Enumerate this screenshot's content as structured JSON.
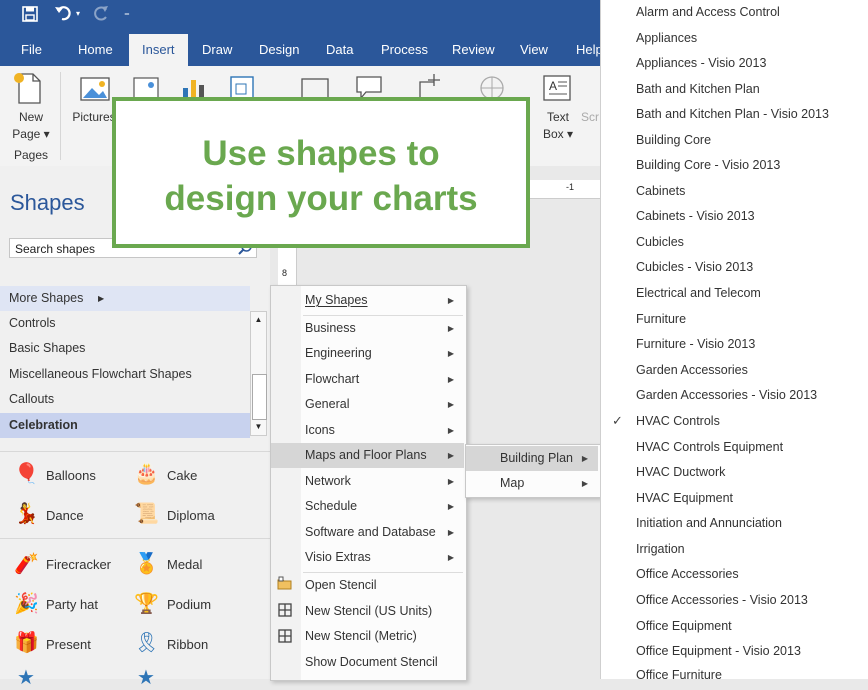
{
  "app": {
    "ribbon_tabs": [
      "File",
      "Home",
      "Insert",
      "Draw",
      "Design",
      "Data",
      "Process",
      "Review",
      "View",
      "Help"
    ],
    "active_tab": "Insert"
  },
  "ribbon": {
    "new_page_line1": "New",
    "new_page_line2": "Page",
    "pictures_label": "Pictures",
    "text_box_line1": "Text",
    "text_box_line2": "Box",
    "partial_label": "Scr",
    "group_pages": "Pages"
  },
  "callout": {
    "line1": "Use shapes to",
    "line2": "design your charts"
  },
  "shapes_pane": {
    "title": "Shapes",
    "search_placeholder": "Search shapes",
    "stencils": [
      "More Shapes",
      "Controls",
      "Basic Shapes",
      "Miscellaneous Flowchart Shapes",
      "Callouts",
      "Celebration"
    ],
    "selected_stencil": "Celebration",
    "items": [
      "Balloons",
      "Cake",
      "Dance",
      "Diploma",
      "Firecracker",
      "Medal",
      "Party hat",
      "Podium",
      "Present",
      "Ribbon"
    ]
  },
  "ruler": {
    "h_mark": "-1",
    "v_mark": "8"
  },
  "more_shapes_menu": {
    "items": [
      "My Shapes",
      "Business",
      "Engineering",
      "Flowchart",
      "General",
      "Icons",
      "Maps and Floor Plans",
      "Network",
      "Schedule",
      "Software and Database",
      "Visio Extras"
    ],
    "highlighted": "Maps and Floor Plans",
    "actions": [
      "Open Stencil",
      "New Stencil (US Units)",
      "New Stencil (Metric)",
      "Show Document Stencil"
    ]
  },
  "maps_menu": {
    "items": [
      "Building Plan",
      "Map"
    ],
    "highlighted": "Building Plan"
  },
  "building_plan_menu": {
    "items": [
      "Alarm and Access Control",
      "Appliances",
      "Appliances - Visio 2013",
      "Bath and Kitchen Plan",
      "Bath and Kitchen Plan - Visio 2013",
      "Building Core",
      "Building Core - Visio 2013",
      "Cabinets",
      "Cabinets - Visio 2013",
      "Cubicles",
      "Cubicles - Visio 2013",
      "Electrical and Telecom",
      "Furniture",
      "Furniture - Visio 2013",
      "Garden Accessories",
      "Garden Accessories - Visio 2013",
      "HVAC Controls",
      "HVAC Controls Equipment",
      "HVAC Ductwork",
      "HVAC Equipment",
      "Initiation and Annunciation",
      "Irrigation",
      "Office Accessories",
      "Office Accessories - Visio 2013",
      "Office Equipment",
      "Office Equipment - Visio 2013",
      "Office Furniture"
    ],
    "checked": "HVAC Controls"
  },
  "colors": {
    "brand_blue": "#2b579a",
    "callout_green": "#6aa84f"
  }
}
